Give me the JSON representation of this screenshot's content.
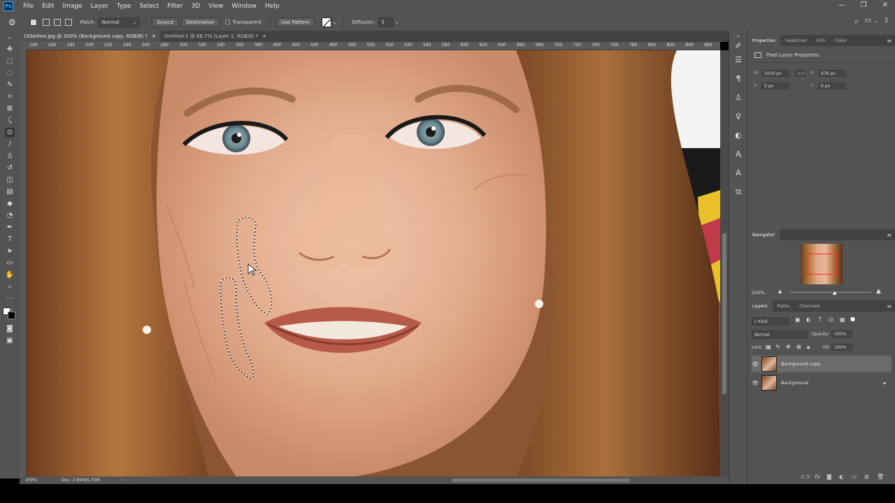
{
  "menubar": {
    "logo": "Ps",
    "items": [
      "File",
      "Edit",
      "Image",
      "Layer",
      "Type",
      "Select",
      "Filter",
      "3D",
      "View",
      "Window",
      "Help"
    ],
    "win_min": "—",
    "win_restore": "❐",
    "win_close": "✕"
  },
  "options": {
    "patch_label": "Patch:",
    "patch_mode": "Normal",
    "source_label": "Source",
    "destination_label": "Destination",
    "transparent_label": "Transparent",
    "use_pattern_label": "Use Pattern",
    "diffusion_label": "Diffusion:",
    "diffusion_value": "5"
  },
  "tabs": [
    {
      "label": "CKbefore.jpg @ 200% (Background copy, RGB/8) *"
    },
    {
      "label": "Untitled-1 @ 66.7% (Layer 1, RGB/8) *"
    }
  ],
  "ruler": {
    "ticks": [
      "140",
      "160",
      "180",
      "200",
      "220",
      "240",
      "260",
      "280",
      "300",
      "320",
      "340",
      "360",
      "380",
      "400",
      "420",
      "440",
      "460",
      "480",
      "500",
      "520",
      "540",
      "560",
      "580",
      "600",
      "620",
      "640",
      "660",
      "680",
      "700",
      "720",
      "740",
      "760",
      "780",
      "800",
      "820",
      "840",
      "860"
    ]
  },
  "status": {
    "zoom": "200%",
    "doc": "Doc: 2.85M/5.70M"
  },
  "properties": {
    "tabs": [
      "Properties",
      "Swatches",
      "Info",
      "Color"
    ],
    "title": "Pixel Layer Properties",
    "w_label": "W:",
    "w_value": "1020 px",
    "h_label": "H:",
    "h_value": "976 px",
    "x_label": "X:",
    "x_value": "0 px",
    "y_label": "Y:",
    "y_value": "0 px"
  },
  "navigator": {
    "title": "Navigator",
    "zoom": "200%"
  },
  "layers": {
    "tabs": [
      "Layers",
      "Paths",
      "Channels"
    ],
    "kind_label": "Kind",
    "blend_mode": "Normal",
    "opacity_label": "Opacity:",
    "opacity_value": "100%",
    "lock_label": "Lock:",
    "fill_label": "Fill:",
    "fill_value": "100%",
    "items": [
      {
        "name": "Background copy"
      },
      {
        "name": "Background"
      }
    ]
  },
  "colors": {
    "ui_bg": "#535353",
    "ui_dark": "#424242",
    "accent": "#31a8ff"
  }
}
